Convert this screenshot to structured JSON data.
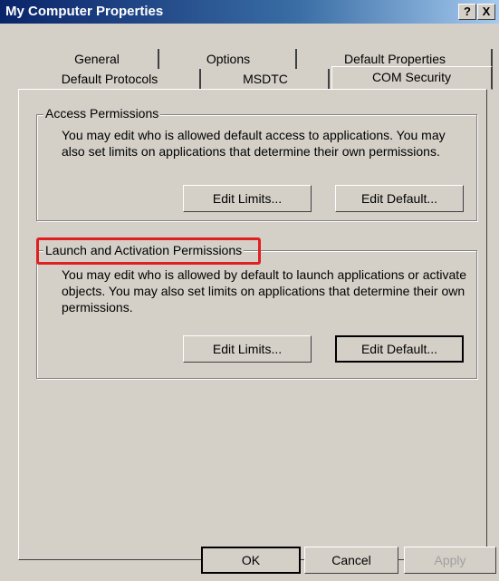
{
  "window": {
    "title": "My Computer Properties"
  },
  "titlebar_buttons": {
    "help": "?",
    "close": "X"
  },
  "tabs": {
    "row1": [
      "General",
      "Options",
      "Default Properties"
    ],
    "row2": [
      "Default Protocols",
      "MSDTC",
      "COM Security"
    ],
    "active": "COM Security"
  },
  "access": {
    "title": "Access Permissions",
    "text": "You may edit who is allowed default access to applications. You may also set limits on applications that determine their own permissions.",
    "edit_limits": "Edit Limits...",
    "edit_default": "Edit Default..."
  },
  "launch": {
    "title": "Launch and Activation Permissions",
    "text": "You may edit who is allowed by default to launch applications or activate objects. You may also set limits on applications that determine their own permissions.",
    "edit_limits": "Edit Limits...",
    "edit_default": "Edit Default..."
  },
  "footer": {
    "ok": "OK",
    "cancel": "Cancel",
    "apply": "Apply"
  },
  "colors": {
    "highlight": "#e02020",
    "titlebar": "#0a246a",
    "face": "#d4d0c8"
  }
}
